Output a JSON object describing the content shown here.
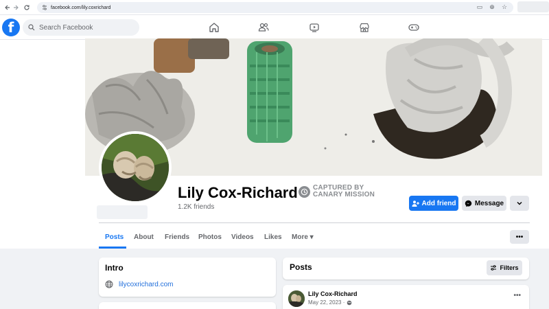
{
  "browser": {
    "url": "facebook.com/lily.coxrichard",
    "back_icon": "arrow-left-icon",
    "forward_icon": "arrow-right-icon",
    "reload_icon": "reload-icon"
  },
  "header": {
    "logo": "f",
    "search_placeholder": "Search Facebook",
    "nav_icons": [
      "home-icon",
      "friends-icon",
      "watch-icon",
      "marketplace-icon",
      "gaming-icon"
    ]
  },
  "profile": {
    "name": "Lily Cox-Richard",
    "friends": "1.2K friends",
    "badge_line1": "CAPTURED BY",
    "badge_line2": "CANARY MISSION",
    "add_friend_label": "Add friend",
    "message_label": "Message"
  },
  "tabs": [
    {
      "label": "Posts",
      "active": true
    },
    {
      "label": "About"
    },
    {
      "label": "Friends"
    },
    {
      "label": "Photos"
    },
    {
      "label": "Videos"
    },
    {
      "label": "Likes"
    },
    {
      "label": "More ▾"
    }
  ],
  "intro": {
    "title": "Intro",
    "website": "lilycoxrichard.com"
  },
  "posts": {
    "title": "Posts",
    "filters_label": "Filters",
    "first_post": {
      "author": "Lily Cox-Richard",
      "date": "May 22, 2023 ·"
    }
  },
  "colors": {
    "brand": "#1877f2",
    "background": "#f0f2f5",
    "muted_text": "#65676b"
  }
}
